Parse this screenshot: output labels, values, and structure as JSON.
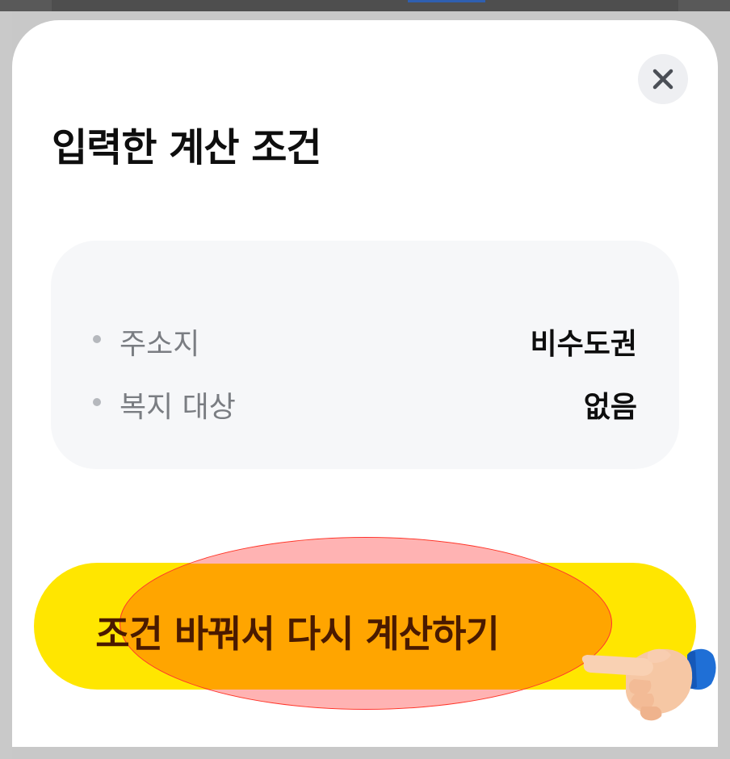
{
  "sheet": {
    "title": "입력한 계산 조건",
    "close_icon": "close-icon"
  },
  "conditions": [
    {
      "label": "주소지",
      "value": "비수도권"
    },
    {
      "label": "복지 대상",
      "value": "없음"
    }
  ],
  "cta": {
    "label": "조건 바꿔서 다시 계산하기",
    "pointer_icon": "pointing-hand-icon"
  },
  "colors": {
    "cta_background": "#ffe600",
    "highlight_fill": "#ffa500",
    "highlight_border": "#ff3030",
    "card_background": "#f6f7f9"
  }
}
